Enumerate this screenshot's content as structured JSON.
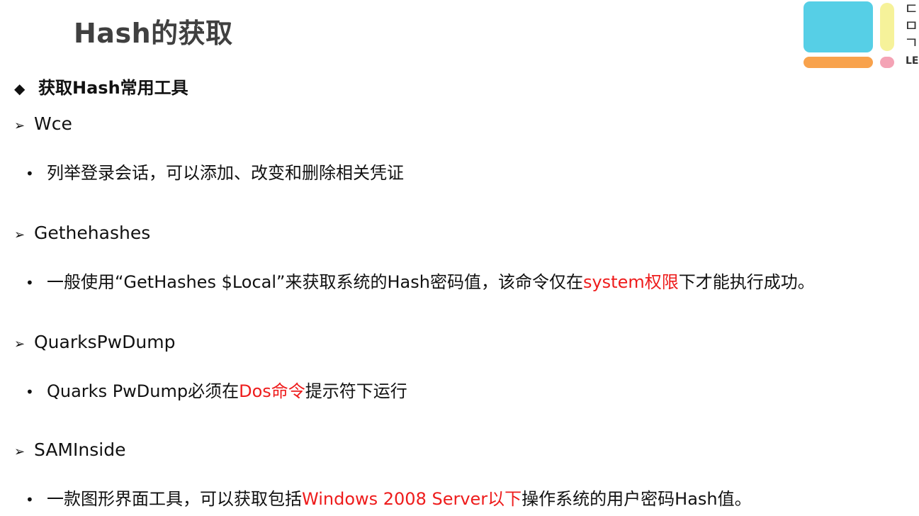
{
  "slide": {
    "title": "Hash的获取",
    "section": "获取Hash常用工具",
    "logo_text": "LE"
  },
  "tools": [
    {
      "name": "Wce",
      "desc": {
        "before": "列举登录会话，可以添加、改变和删除相关凭证",
        "highlight": "",
        "after": ""
      }
    },
    {
      "name": "Gethehashes",
      "desc": {
        "before": "一般使用“GetHashes $Local”来获取系统的Hash密码值，该命令仅在",
        "highlight": "system权限",
        "after": "下才能执行成功。"
      }
    },
    {
      "name": "QuarksPwDump",
      "desc": {
        "before": "Quarks PwDump必须在",
        "highlight": "Dos命令",
        "after": "提示符下运行"
      }
    },
    {
      "name": "SAMInside",
      "desc": {
        "before": "一款图形界面工具，可以获取包括",
        "highlight": "Windows 2008 Server以下",
        "after": "操作系统的用户密码Hash值。"
      }
    }
  ],
  "colors": {
    "highlight": "#ee1c1c",
    "title": "#404040",
    "logo_blue": "#56cfe6",
    "logo_yellow": "#f6f29a",
    "logo_orange": "#f8a24c",
    "logo_pink": "#f4a3b5"
  },
  "icons": {
    "section_bullet": "diamond-icon",
    "tool_bullet": "arrow-bullet-icon",
    "desc_bullet": "dot-bullet-icon"
  }
}
